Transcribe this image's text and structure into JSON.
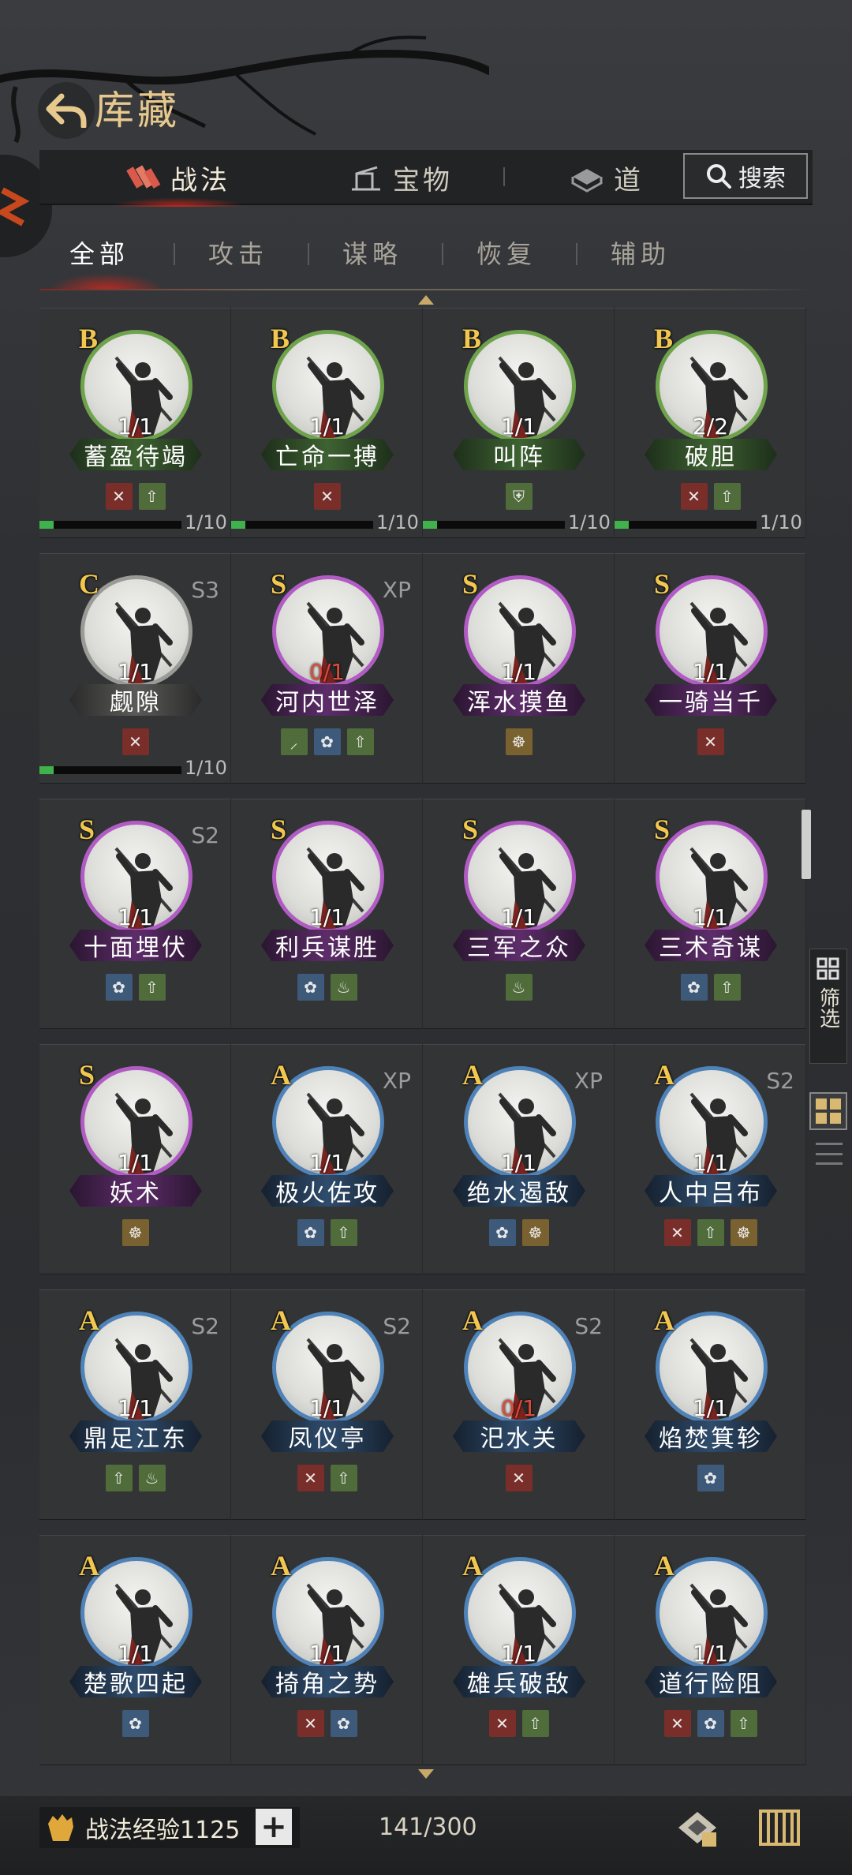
{
  "header": {
    "title": "库藏"
  },
  "main_tabs": [
    {
      "label": "战法",
      "icon": "bundle-icon",
      "active": true
    },
    {
      "label": "宝物",
      "icon": "treasure-icon",
      "active": false
    },
    {
      "label": "道",
      "icon": "item-icon",
      "active": false
    }
  ],
  "search": {
    "label": "搜索"
  },
  "sub_tabs": [
    {
      "label": "全部",
      "active": true
    },
    {
      "label": "攻击",
      "active": false
    },
    {
      "label": "谋略",
      "active": false
    },
    {
      "label": "恢复",
      "active": false
    },
    {
      "label": "辅助",
      "active": false
    }
  ],
  "cards": [
    {
      "grade": "B",
      "name": "蓄盈待竭",
      "count": "1/1",
      "tag": "",
      "icons": [
        "attack",
        "buff"
      ],
      "progress": "1/10",
      "progress_fraction": 0.1
    },
    {
      "grade": "B",
      "name": "亡命一搏",
      "count": "1/1",
      "tag": "",
      "icons": [
        "attack"
      ],
      "progress": "1/10",
      "progress_fraction": 0.1
    },
    {
      "grade": "B",
      "name": "叫阵",
      "count": "1/1",
      "tag": "",
      "icons": [
        "shield"
      ],
      "progress": "1/10",
      "progress_fraction": 0.1
    },
    {
      "grade": "B",
      "name": "破胆",
      "count": "2/2",
      "tag": "",
      "icons": [
        "attack",
        "buff"
      ],
      "progress": "1/10",
      "progress_fraction": 0.1
    },
    {
      "grade": "C",
      "name": "觑隙",
      "count": "1/1",
      "tag": "S3",
      "icons": [
        "attack"
      ],
      "progress": "1/10",
      "progress_fraction": 0.1
    },
    {
      "grade": "S",
      "name": "河内世泽",
      "count": "0/1",
      "tag": "XP",
      "icons": [
        "sword",
        "heal",
        "buff"
      ],
      "progress": "",
      "progress_fraction": null
    },
    {
      "grade": "S",
      "name": "浑水摸鱼",
      "count": "1/1",
      "tag": "",
      "icons": [
        "control"
      ],
      "progress": "",
      "progress_fraction": null
    },
    {
      "grade": "S",
      "name": "一骑当千",
      "count": "1/1",
      "tag": "",
      "icons": [
        "attack"
      ],
      "progress": "",
      "progress_fraction": null
    },
    {
      "grade": "S",
      "name": "十面埋伏",
      "count": "1/1",
      "tag": "S2",
      "icons": [
        "heal",
        "buff"
      ],
      "progress": "",
      "progress_fraction": null
    },
    {
      "grade": "S",
      "name": "利兵谋胜",
      "count": "1/1",
      "tag": "",
      "icons": [
        "heal",
        "tea"
      ],
      "progress": "",
      "progress_fraction": null
    },
    {
      "grade": "S",
      "name": "三军之众",
      "count": "1/1",
      "tag": "",
      "icons": [
        "tea"
      ],
      "progress": "",
      "progress_fraction": null
    },
    {
      "grade": "S",
      "name": "三术奇谋",
      "count": "1/1",
      "tag": "",
      "icons": [
        "heal",
        "buff"
      ],
      "progress": "",
      "progress_fraction": null
    },
    {
      "grade": "S",
      "name": "妖术",
      "count": "1/1",
      "tag": "",
      "icons": [
        "control"
      ],
      "progress": "",
      "progress_fraction": null
    },
    {
      "grade": "A",
      "name": "极火佐攻",
      "count": "1/1",
      "tag": "XP",
      "icons": [
        "heal",
        "buff"
      ],
      "progress": "",
      "progress_fraction": null
    },
    {
      "grade": "A",
      "name": "绝水遏敌",
      "count": "1/1",
      "tag": "XP",
      "icons": [
        "heal",
        "control"
      ],
      "progress": "",
      "progress_fraction": null
    },
    {
      "grade": "A",
      "name": "人中吕布",
      "count": "1/1",
      "tag": "S2",
      "icons": [
        "attack",
        "buff",
        "control"
      ],
      "progress": "",
      "progress_fraction": null
    },
    {
      "grade": "A",
      "name": "鼎足江东",
      "count": "1/1",
      "tag": "S2",
      "icons": [
        "buff",
        "tea"
      ],
      "progress": "",
      "progress_fraction": null
    },
    {
      "grade": "A",
      "name": "凤仪亭",
      "count": "1/1",
      "tag": "S2",
      "icons": [
        "attack",
        "buff"
      ],
      "progress": "",
      "progress_fraction": null
    },
    {
      "grade": "A",
      "name": "汜水关",
      "count": "0/1",
      "tag": "S2",
      "icons": [
        "attack"
      ],
      "progress": "",
      "progress_fraction": null
    },
    {
      "grade": "A",
      "name": "焰焚箕轸",
      "count": "1/1",
      "tag": "",
      "icons": [
        "heal"
      ],
      "progress": "",
      "progress_fraction": null
    },
    {
      "grade": "A",
      "name": "楚歌四起",
      "count": "1/1",
      "tag": "",
      "icons": [
        "heal"
      ],
      "progress": "",
      "progress_fraction": null
    },
    {
      "grade": "A",
      "name": "掎角之势",
      "count": "1/1",
      "tag": "",
      "icons": [
        "attack",
        "heal"
      ],
      "progress": "",
      "progress_fraction": null
    },
    {
      "grade": "A",
      "name": "雄兵破敌",
      "count": "1/1",
      "tag": "",
      "icons": [
        "attack",
        "buff"
      ],
      "progress": "",
      "progress_fraction": null
    },
    {
      "grade": "A",
      "name": "道行险阻",
      "count": "1/1",
      "tag": "",
      "icons": [
        "attack",
        "heal",
        "buff"
      ],
      "progress": "",
      "progress_fraction": null
    }
  ],
  "side": {
    "filter_label": "筛选"
  },
  "footer": {
    "exp_label": "战法经验1125",
    "plus_label": "+",
    "capacity": "141/300"
  },
  "colors": {
    "grade_gold": "#f1c750",
    "quality_B": "#6ea34c",
    "quality_C": "#9a9a96",
    "quality_S": "#b15bc4",
    "quality_A": "#4e82b8",
    "accent_red": "#c8281e"
  }
}
